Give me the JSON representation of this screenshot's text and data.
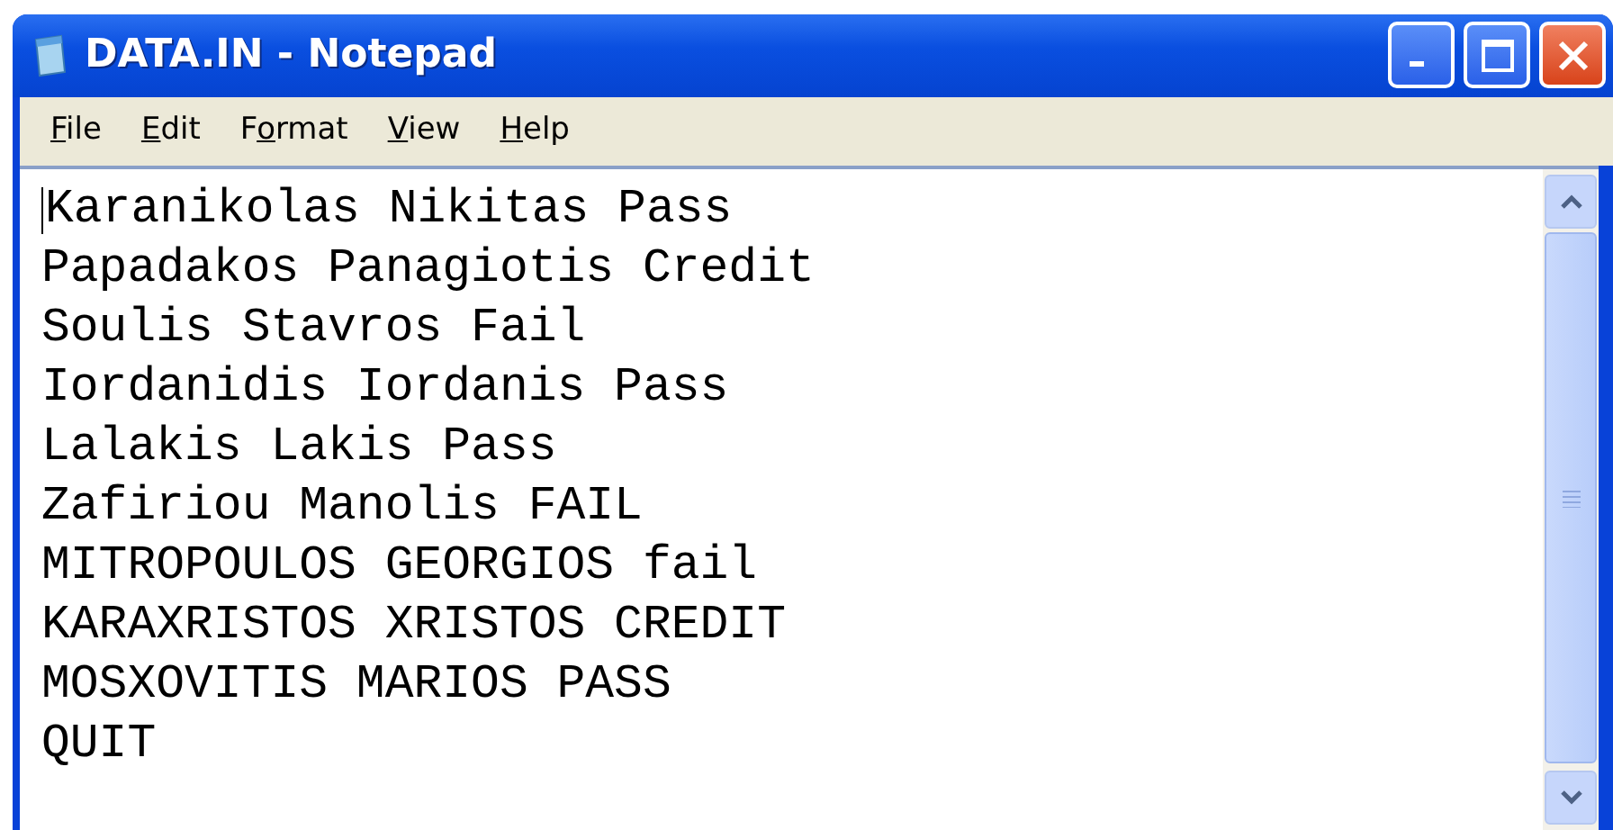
{
  "window": {
    "title": "DATA.IN - Notepad"
  },
  "menu": [
    {
      "access_key": "F",
      "rest": "ile"
    },
    {
      "access_key": "E",
      "rest": "dit"
    },
    {
      "before": "F",
      "access_key": "o",
      "rest": "rmat"
    },
    {
      "access_key": "V",
      "rest": "iew"
    },
    {
      "access_key": "H",
      "rest": "elp"
    }
  ],
  "lines": [
    "Karanikolas Nikitas Pass",
    "Papadakos Panagiotis Credit",
    "Soulis Stavros Fail",
    "Iordanidis Iordanis Pass",
    "Lalakis Lakis Pass",
    "Zafiriou Manolis FAIL",
    "MITROPOULOS GEORGIOS fail",
    "KARAXRISTOS XRISTOS CREDIT",
    "MOSXOVITIS MARIOS PASS",
    "QUIT"
  ]
}
